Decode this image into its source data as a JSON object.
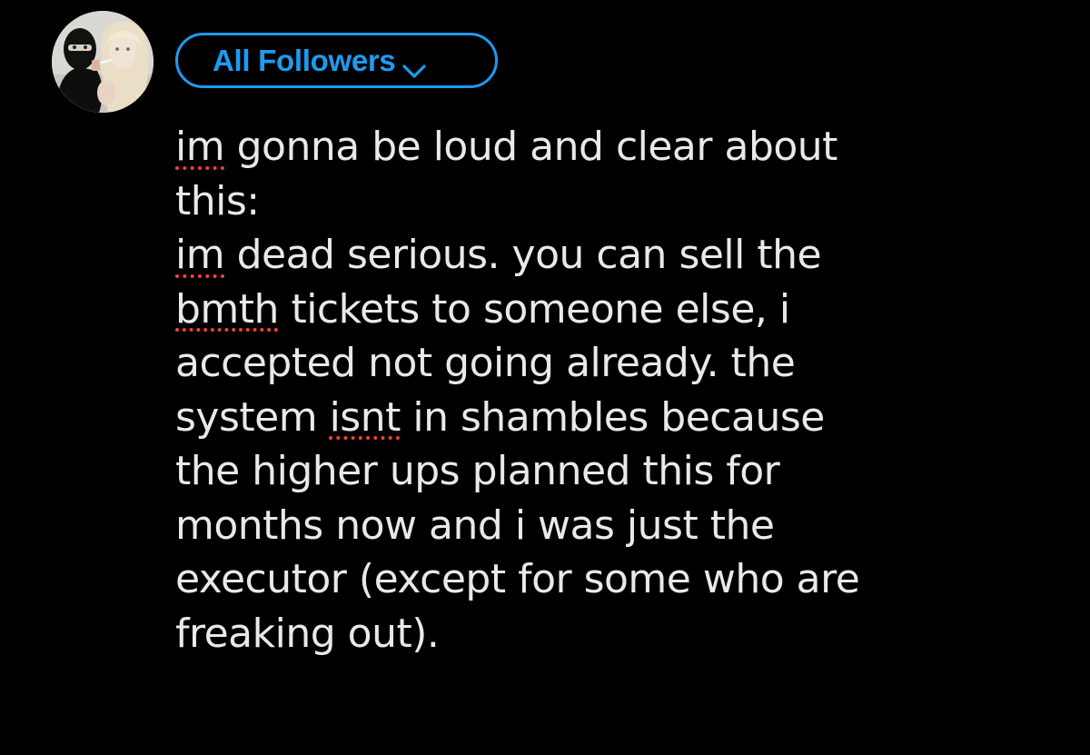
{
  "composer": {
    "audience_label": "All Followers",
    "audience_icon": "chevron-down-icon",
    "accent_color": "#1d9bf0",
    "spellcheck_color": "#ef4136",
    "background": "#000000",
    "text_color": "#e7e9ea",
    "lines": [
      "im gonna be loud and clear about",
      "this:",
      "im dead serious. you can sell the",
      "bmth tickets to someone else, i",
      "accepted not going already. the",
      "system isnt in shambles because",
      "the higher ups planned this for",
      "months now and i was just the",
      "executor (except for some who are",
      "freaking out)."
    ],
    "spellcheck_words": [
      "im",
      "bmth",
      "isnt"
    ]
  }
}
